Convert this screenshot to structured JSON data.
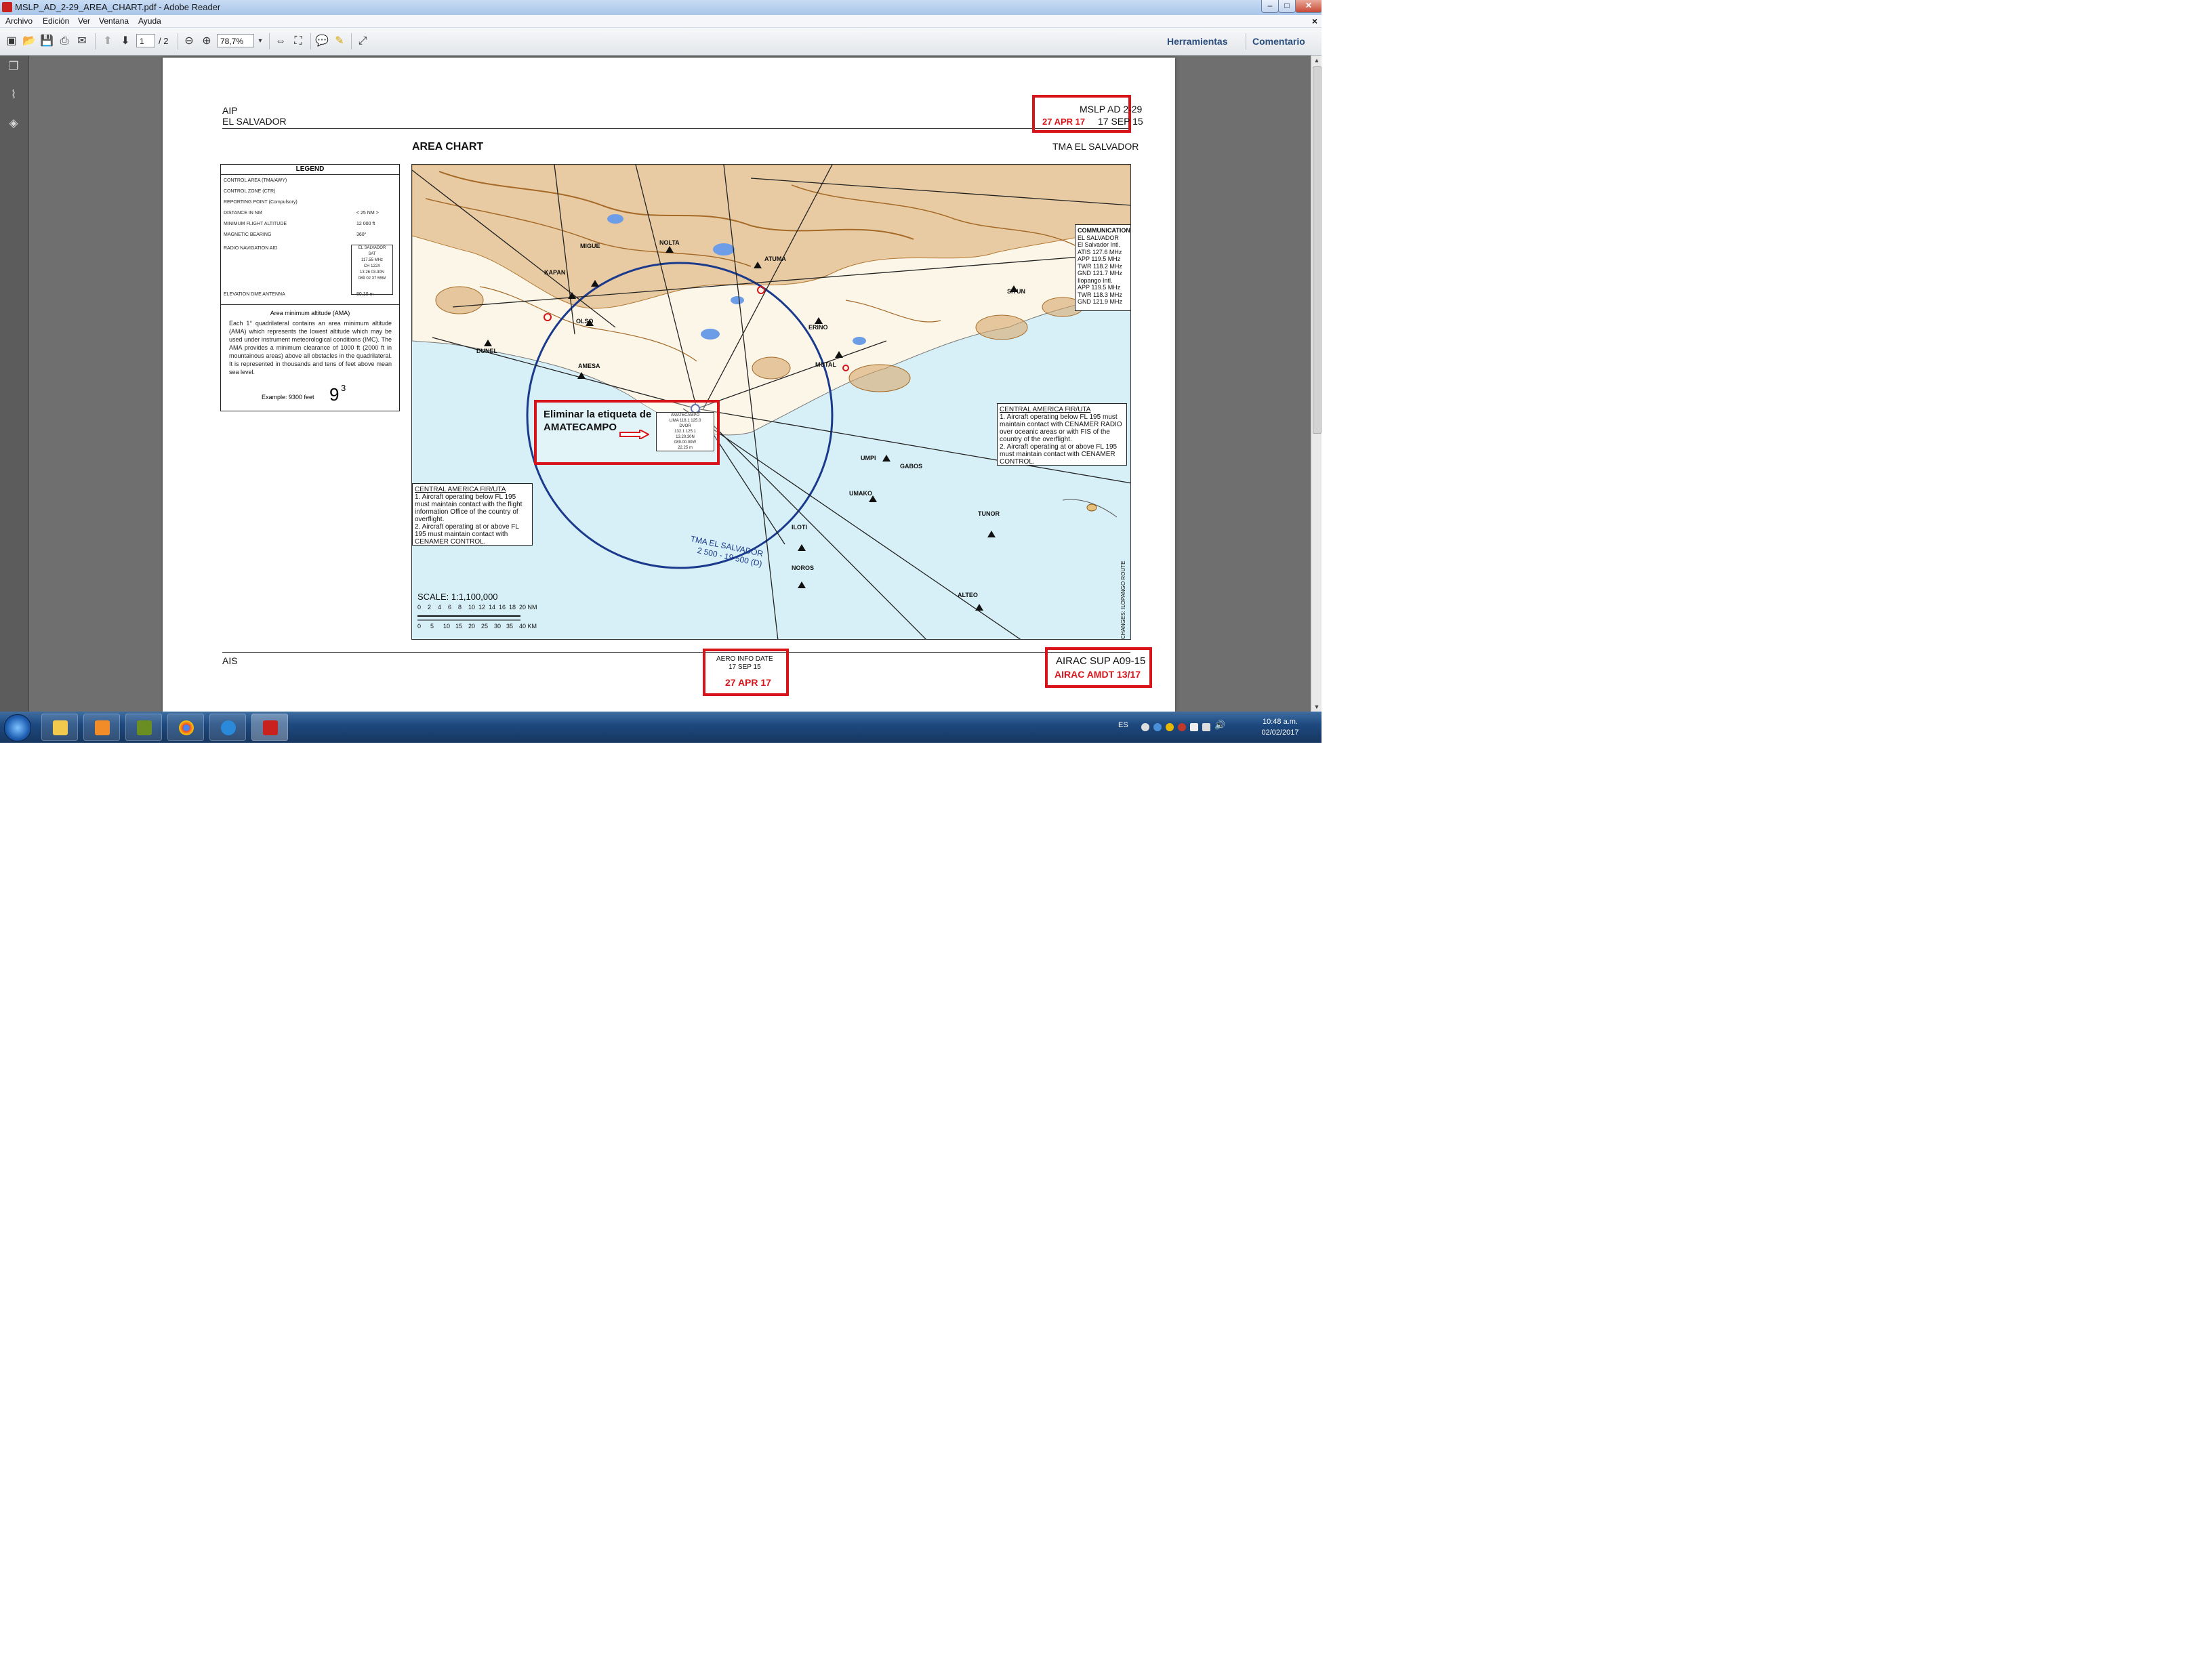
{
  "window": {
    "title": "MSLP_AD_2-29_AREA_CHART.pdf - Adobe Reader",
    "minimize": "–",
    "maximize": "□",
    "close": "✕"
  },
  "menu": {
    "items": [
      "Archivo",
      "Edición",
      "Ver",
      "Ventana",
      "Ayuda"
    ],
    "close_doc": "×"
  },
  "toolbar": {
    "page_current": "1",
    "page_total": "/ 2",
    "zoom": "78,7%",
    "herramientas": "Herramientas",
    "comentario": "Comentario"
  },
  "page": {
    "header_left_1": "AIP",
    "header_left_2": "EL SALVADOR",
    "header_right_1": "MSLP AD 2-29",
    "header_right_red": "27 APR 17",
    "header_right_2": "17 SEP 15",
    "chart_title": "AREA CHART",
    "chart_subtitle": "TMA EL SALVADOR",
    "footer_left": "AIS",
    "aero_title": "AERO INFO DATE",
    "aero_date": "17 SEP 15",
    "aero_red": "27 APR 17",
    "airac_sup": "AIRAC SUP A09-15",
    "airac_amdt": "AIRAC AMDT 13/17"
  },
  "legend": {
    "title": "LEGEND",
    "rows": [
      "CONTROL AREA (TMA/AWY)",
      "CONTROL ZONE (CTR)",
      "REPORTING POINT (Compulsory)",
      "DISTANCE IN NM",
      "MINIMUM FLIGHT ALTITUDE",
      "MAGNETIC BEARING",
      "RADIO NAVIGATION AID",
      "ELEVATION DME ANTENNA"
    ],
    "row_values": [
      "",
      "",
      "",
      "< 25 NM >",
      "12 000 ft",
      "360°",
      "",
      "80.10 m"
    ],
    "navaid_block": [
      "EL SALVADOR",
      "SAT",
      "117.55 MHz",
      "CH 122X",
      "13 26 03.30N",
      "089 02 37.55W"
    ],
    "ama_title": "Area minimum altitude (AMA)",
    "ama_text": "Each 1° quadrilateral contains an area minimum altitude (AMA) which represents the lowest altitude which may be used under instrument meteorological conditions (IMC). The AMA provides a minimum clearance of 1000 ft (2000 ft in mountainous areas) above all obstacles in the quadrilateral. It is represented in thousands and tens of feet above mean sea level.",
    "example_label": "Example: 9300 feet",
    "example_big": "9",
    "example_sup": "3"
  },
  "map": {
    "communications": {
      "title": "COMMUNICATIONS",
      "lines": [
        "EL SALVADOR",
        "El Salvador Intl.",
        "ATIS   127.6 MHz",
        "APP    119.5 MHz",
        "TWR  118.2 MHz",
        "GND   121.7 MHz",
        "Ilopango Intl.",
        "APP    119.5 MHz",
        "TWR  118.3 MHz",
        "GND   121.9 MHz"
      ]
    },
    "fir_right": {
      "title": "CENTRAL AMERICA FIR/UTA",
      "lines": [
        "1. Aircraft operating below FL 195 must maintain contact with CENAMER RADIO over oceanic areas or with FIS of the country of the overflight.",
        "2. Aircraft operating at or above FL 195 must maintain contact with CENAMER CONTROL."
      ]
    },
    "fir_left": {
      "title": "CENTRAL AMERICA FIR/UTA",
      "lines": [
        "1. Aircraft operating below FL 195 must maintain contact with the flight information Office of the country of overflight.",
        "2. Aircraft operating at or above FL 195 must maintain contact with CENAMER CONTROL."
      ]
    },
    "tma_label": "TMA EL SALVADOR",
    "tma_limits": "2 500 - 19 500 (D)",
    "scale_title": "SCALE: 1:1,100,000",
    "scale_nm_labels": [
      "0",
      "2",
      "4",
      "6",
      "8",
      "10",
      "12",
      "14",
      "16",
      "18",
      "20 NM"
    ],
    "scale_km_labels": [
      "0",
      "5",
      "10",
      "15",
      "20",
      "25",
      "30",
      "35",
      "40 KM"
    ],
    "points": [
      "KAPAN",
      "MIGUE",
      "NOLTA",
      "ATUMA",
      "OLSO",
      "AMESA",
      "DUNEL",
      "ERINO",
      "MUTAL",
      "UMPI",
      "GABOS",
      "UMAKO",
      "TUNOR",
      "ILOTI",
      "NOROS",
      "ALTEO",
      "SITUN"
    ],
    "draft_note": "CHANGES: ILOPANGO ROUTE"
  },
  "annotation": {
    "line1": "Eliminar la etiqueta de",
    "line2": "AMATECAMPO",
    "label_lines": [
      "AMATECAMPO",
      "LIMA 118.1 125.0",
      "DVOR",
      "132.1 125.1",
      "13.20.30N",
      "089.00.00W",
      "22.25 m"
    ]
  },
  "taskbar": {
    "lang": "ES",
    "time": "10:48 a.m.",
    "date": "02/02/2017"
  },
  "colors": {
    "red_markup": "#d8141b",
    "sea": "#d7f0f7",
    "terrain": "#c99a5b",
    "tma_ring": "#1b3a8c"
  }
}
